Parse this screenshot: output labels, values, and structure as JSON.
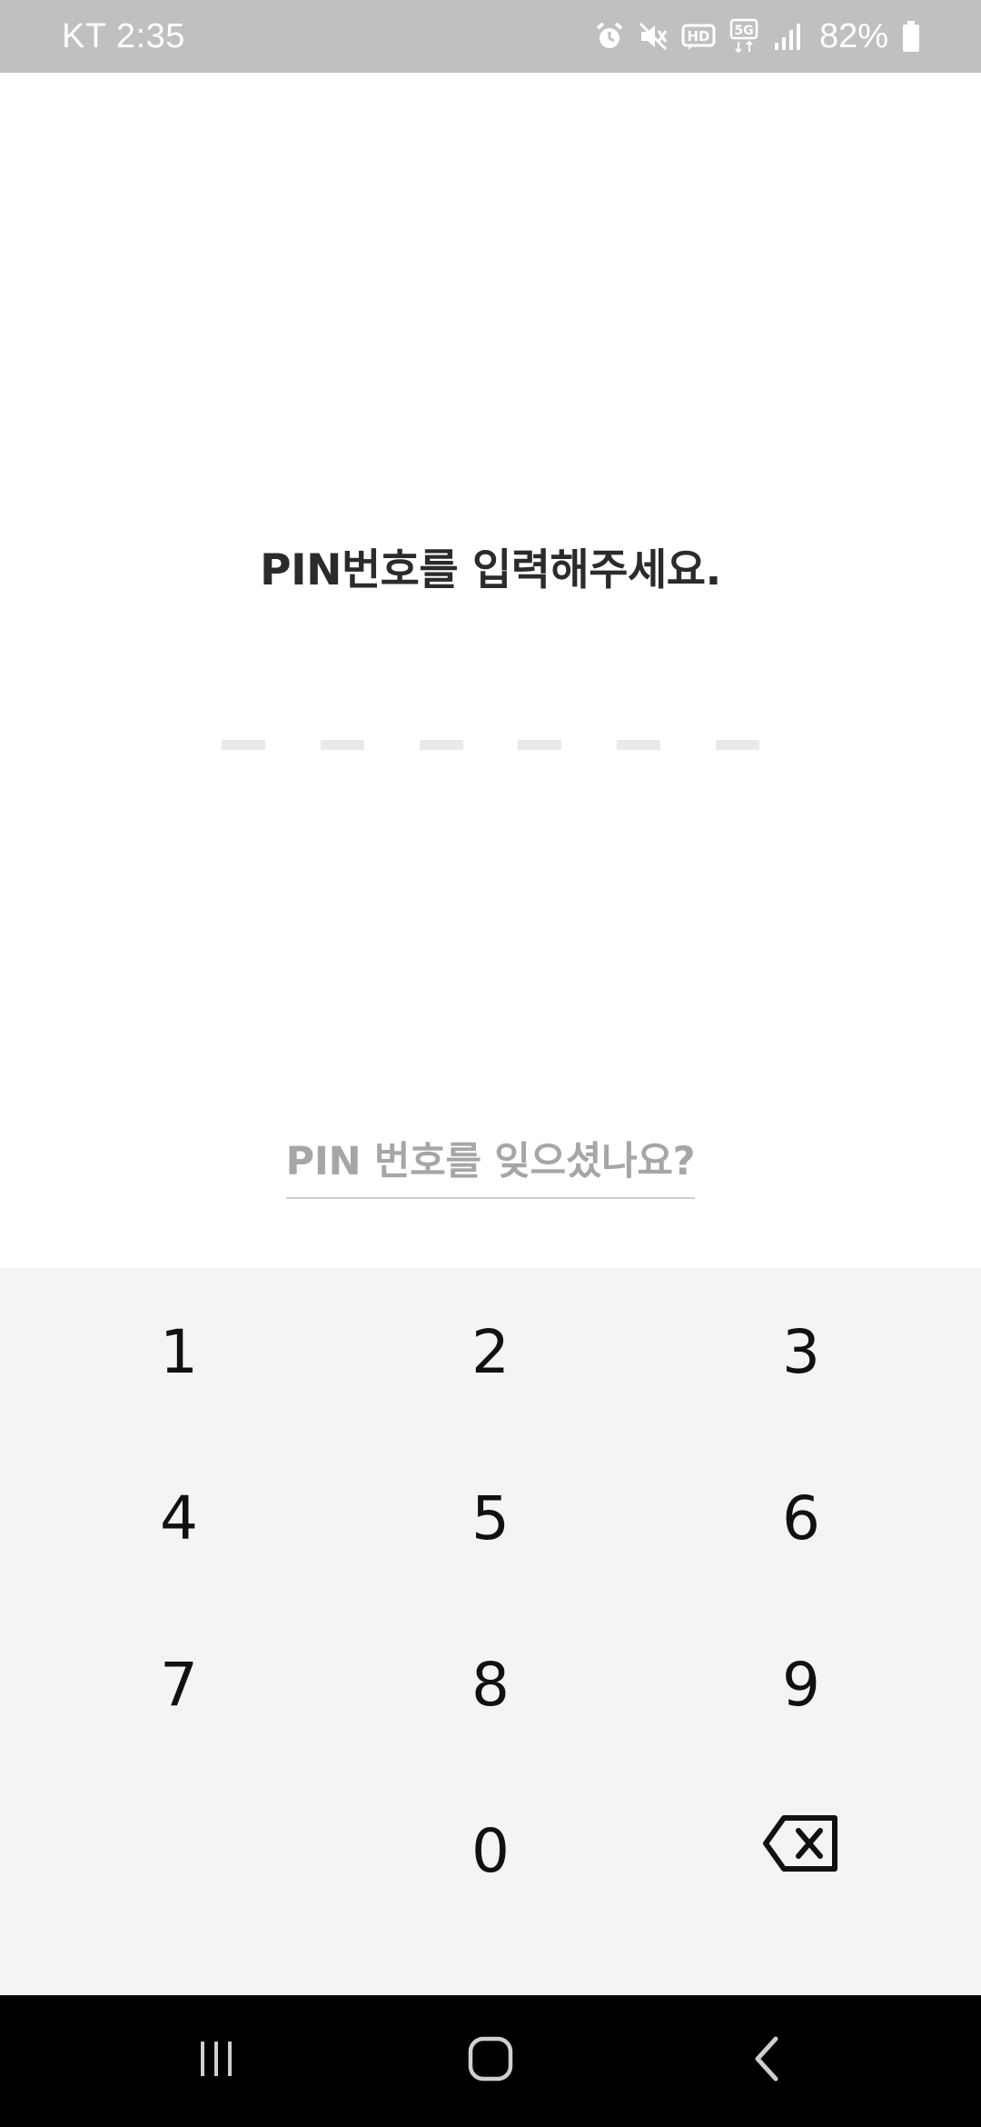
{
  "status_bar": {
    "carrier_time": "KT 2:35",
    "battery_percent": "82%",
    "icons": [
      "alarm-icon",
      "mute-icon",
      "hd-icon",
      "5g-icon",
      "signal-icon",
      "battery-icon"
    ]
  },
  "pin_screen": {
    "title": "PIN번호를 입력해주세요.",
    "digits_entered": 0,
    "digits_total": 6,
    "forgot_link": "PIN 번호를 잊으셨나요?"
  },
  "keypad": {
    "keys": [
      "1",
      "2",
      "3",
      "4",
      "5",
      "6",
      "7",
      "8",
      "9",
      "",
      "0"
    ],
    "backspace_icon": "backspace-icon"
  },
  "nav_bar": {
    "icons": [
      "recent-apps-icon",
      "home-icon",
      "back-icon"
    ]
  },
  "colors": {
    "status_bar_bg": "#c0c0c0",
    "title_text": "#2b2b2b",
    "slot_empty": "#e9e9e9",
    "link_text": "#a6a6a6",
    "keypad_bg": "#f4f4f4",
    "nav_bg": "#000000"
  }
}
